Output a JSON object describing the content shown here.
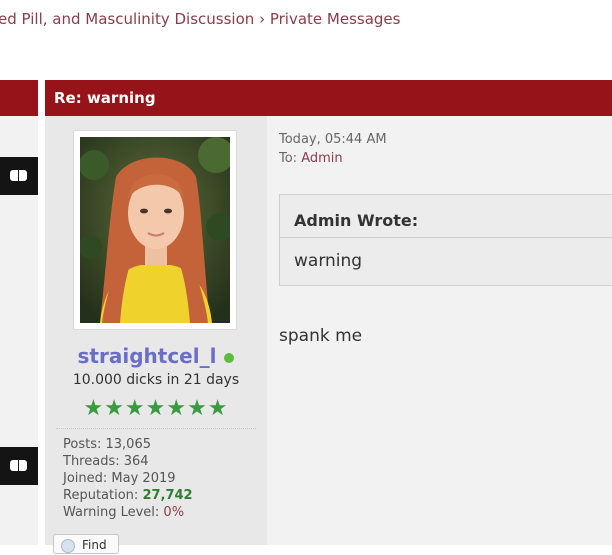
{
  "breadcrumb": {
    "forum": "ed Pill, and Masculinity Discussion",
    "separator": "›",
    "current": "Private Messages"
  },
  "post": {
    "title": "Re: warning",
    "date": "Today, 05:44 AM",
    "to_label": "To:",
    "recipient": "Admin",
    "quote": {
      "author": "Admin Wrote:",
      "text": "warning"
    },
    "message": "spank me"
  },
  "user": {
    "name": "straightcel_l",
    "title": "10.000 dicks in 21 days",
    "stars": "★★★★★★★",
    "online": true,
    "online_color": "#5bbd3a",
    "stats": {
      "posts_label": "Posts:",
      "posts": "13,065",
      "threads_label": "Threads:",
      "threads": "364",
      "joined_label": "Joined:",
      "joined": "May 2019",
      "reputation_label": "Reputation:",
      "reputation": "27,742",
      "warning_label": "Warning Level:",
      "warning": "0%"
    },
    "find_button": "Find"
  },
  "colors": {
    "header": "#961419",
    "username": "#6b6ec7",
    "link": "#8a3c4a",
    "stars": "#3a9a3f",
    "reputation": "#2e7d32"
  },
  "icons": [
    "toggle-icon",
    "online-status-icon",
    "find-icon"
  ]
}
